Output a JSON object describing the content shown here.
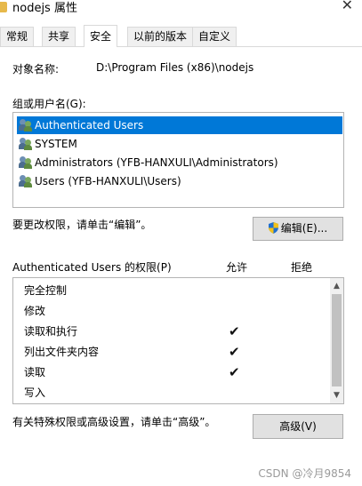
{
  "window": {
    "title": "nodejs 属性",
    "close_glyph": "✕"
  },
  "tabs": [
    {
      "label": "常规",
      "active": false
    },
    {
      "label": "共享",
      "active": false
    },
    {
      "label": "安全",
      "active": true
    },
    {
      "label": "以前的版本",
      "active": false
    },
    {
      "label": "自定义",
      "active": false
    }
  ],
  "object": {
    "label": "对象名称:",
    "value": "D:\\Program Files (x86)\\nodejs"
  },
  "groups": {
    "label": "组或用户名(G):",
    "items": [
      {
        "name": "Authenticated Users",
        "selected": true,
        "icon": "users-icon"
      },
      {
        "name": "SYSTEM",
        "selected": false,
        "icon": "users-icon"
      },
      {
        "name": "Administrators (YFB-HANXULI\\Administrators)",
        "selected": false,
        "icon": "users-icon"
      },
      {
        "name": "Users (YFB-HANXULI\\Users)",
        "selected": false,
        "icon": "users-icon"
      }
    ]
  },
  "edit": {
    "hint": "要更改权限，请单击“编辑”。",
    "button_label": "编辑(E)...",
    "icon": "shield-icon"
  },
  "permissions": {
    "header": "Authenticated Users 的权限(P)",
    "allow_label": "允许",
    "deny_label": "拒绝",
    "check_glyph": "✔",
    "rows": [
      {
        "name": "完全控制",
        "allow": false
      },
      {
        "name": "修改",
        "allow": false
      },
      {
        "name": "读取和执行",
        "allow": true
      },
      {
        "name": "列出文件夹内容",
        "allow": true
      },
      {
        "name": "读取",
        "allow": true
      },
      {
        "name": "写入",
        "allow": false
      }
    ]
  },
  "advanced": {
    "hint": "有关特殊权限或高级设置，请单击“高级”。",
    "button_label": "高级(V)"
  },
  "watermark": "CSDN @冷月9854",
  "colors": {
    "selection": "#0078d7",
    "button_bg": "#e1e1e1"
  }
}
